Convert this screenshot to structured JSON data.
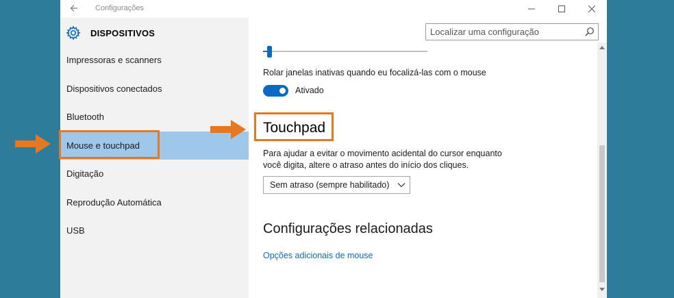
{
  "window": {
    "title": "Configurações"
  },
  "header": {
    "title": "DISPOSITIVOS",
    "icon": "gear-icon"
  },
  "search": {
    "placeholder": "Localizar uma configuração"
  },
  "sidebar": {
    "items": [
      {
        "label": "Impressoras e scanners"
      },
      {
        "label": "Dispositivos conectados"
      },
      {
        "label": "Bluetooth"
      },
      {
        "label": "Mouse e touchpad",
        "selected": true
      },
      {
        "label": "Digitação"
      },
      {
        "label": "Reprodução Automática"
      },
      {
        "label": "USB"
      }
    ]
  },
  "content": {
    "inactive_scroll_label": "Rolar janelas inativas quando eu focalizá-las com o mouse",
    "toggle_state_label": "Ativado",
    "touchpad_title": "Touchpad",
    "touchpad_desc_line1": "Para ajudar a evitar o movimento acidental do cursor enquanto",
    "touchpad_desc_line2": "você digita, altere o atraso antes do início dos cliques.",
    "delay_selected": "Sem atraso (sempre habilitado)",
    "related_title": "Configurações relacionadas",
    "related_link": "Opções adicionais de mouse"
  },
  "colors": {
    "accent": "#0a6ac6",
    "selection": "#9ec7ea",
    "annotation": "#e87820",
    "background": "#2d7d9a"
  }
}
